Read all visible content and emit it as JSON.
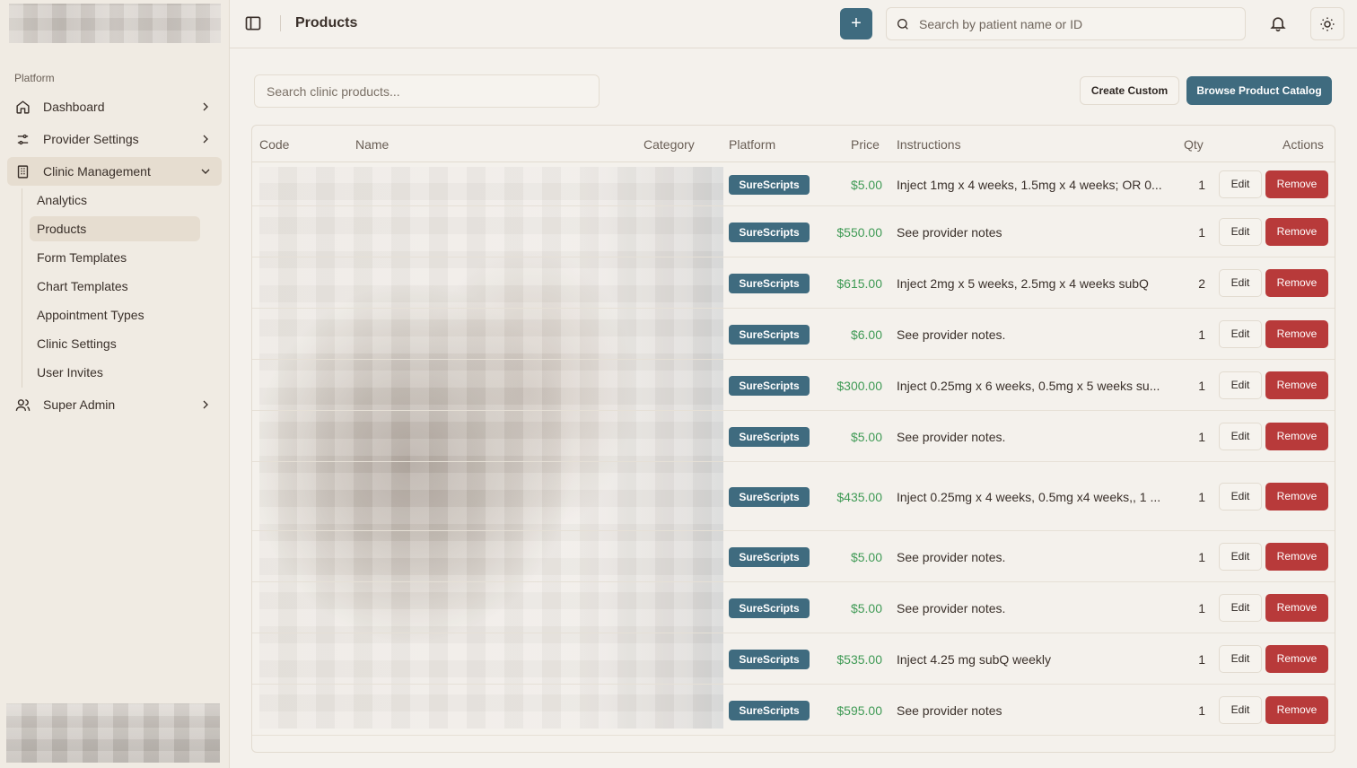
{
  "sidebar": {
    "section_label": "Platform",
    "items": [
      {
        "label": "Dashboard"
      },
      {
        "label": "Provider Settings"
      },
      {
        "label": "Clinic Management"
      },
      {
        "label": "Super Admin"
      }
    ],
    "sub_items": [
      {
        "label": "Analytics"
      },
      {
        "label": "Products"
      },
      {
        "label": "Form Templates"
      },
      {
        "label": "Chart Templates"
      },
      {
        "label": "Appointment Types"
      },
      {
        "label": "Clinic Settings"
      },
      {
        "label": "User Invites"
      }
    ]
  },
  "header": {
    "title": "Products",
    "add_label": "+",
    "search_placeholder": "Search by patient name or ID"
  },
  "toolbar": {
    "search_placeholder": "Search clinic products...",
    "create_custom_label": "Create Custom",
    "browse_catalog_label": "Browse Product Catalog"
  },
  "table": {
    "columns": {
      "code": "Code",
      "name": "Name",
      "category": "Category",
      "platform": "Platform",
      "price": "Price",
      "instructions": "Instructions",
      "qty": "Qty",
      "actions": "Actions"
    },
    "edit_label": "Edit",
    "remove_label": "Remove",
    "rows": [
      {
        "platform": "SureScripts",
        "price": "$5.00",
        "instructions": "Inject 1mg x 4 weeks, 1.5mg x 4 weeks; OR 0...",
        "qty": "1"
      },
      {
        "platform": "SureScripts",
        "price": "$550.00",
        "instructions": "See provider notes",
        "qty": "1"
      },
      {
        "platform": "SureScripts",
        "price": "$615.00",
        "instructions": "Inject 2mg x 5 weeks, 2.5mg x 4 weeks subQ",
        "qty": "2"
      },
      {
        "platform": "SureScripts",
        "price": "$6.00",
        "instructions": "See provider notes.",
        "qty": "1"
      },
      {
        "platform": "SureScripts",
        "price": "$300.00",
        "instructions": "Inject 0.25mg x 6 weeks, 0.5mg x 5 weeks su...",
        "qty": "1"
      },
      {
        "platform": "SureScripts",
        "price": "$5.00",
        "instructions": "See provider notes.",
        "qty": "1"
      },
      {
        "platform": "SureScripts",
        "price": "$435.00",
        "instructions": "Inject 0.25mg x 4 weeks, 0.5mg x4 weeks,, 1 ...",
        "qty": "1"
      },
      {
        "platform": "SureScripts",
        "price": "$5.00",
        "instructions": "See provider notes.",
        "qty": "1"
      },
      {
        "platform": "SureScripts",
        "price": "$5.00",
        "instructions": "See provider notes.",
        "qty": "1"
      },
      {
        "platform": "SureScripts",
        "price": "$535.00",
        "instructions": "Inject 4.25 mg subQ weekly",
        "qty": "1"
      },
      {
        "platform": "SureScripts",
        "price": "$595.00",
        "instructions": "See provider notes",
        "qty": "1"
      }
    ]
  }
}
